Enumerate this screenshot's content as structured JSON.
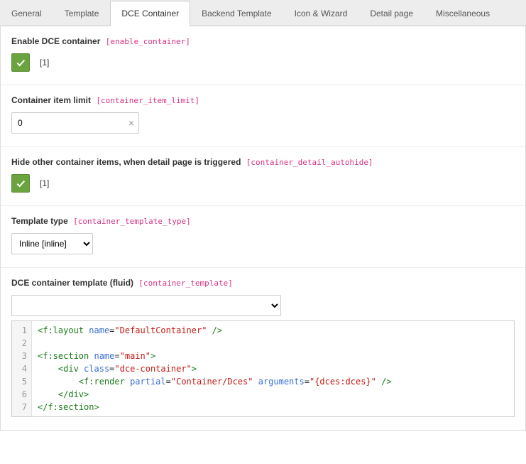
{
  "tabs": {
    "items": [
      {
        "label": "General"
      },
      {
        "label": "Template"
      },
      {
        "label": "DCE Container"
      },
      {
        "label": "Backend Template"
      },
      {
        "label": "Icon & Wizard"
      },
      {
        "label": "Detail page"
      },
      {
        "label": "Miscellaneous"
      }
    ],
    "active_index": 2
  },
  "sections": {
    "enable": {
      "label": "Enable DCE container",
      "field": "[enable_container]",
      "value_text": "[1]"
    },
    "limit": {
      "label": "Container item limit",
      "field": "[container_item_limit]",
      "value": "0"
    },
    "autohide": {
      "label": "Hide other container items, when detail page is triggered",
      "field": "[container_detail_autohide]",
      "value_text": "[1]"
    },
    "template_type": {
      "label": "Template type",
      "field": "[container_template_type]",
      "selected": "Inline [inline]"
    },
    "template": {
      "label": "DCE container template (fluid)",
      "field": "[container_template]",
      "selected": "",
      "code": {
        "lines": [
          "1",
          "2",
          "3",
          "4",
          "5",
          "6",
          "7"
        ],
        "l1_tag_open": "<f:layout",
        "l1_attr": "name",
        "l1_val": "\"DefaultContainer\"",
        "l1_tag_close": " />",
        "l3_tag_open": "<f:section",
        "l3_attr": "name",
        "l3_val": "\"main\"",
        "l3_tag_close": ">",
        "l4_open": "<div",
        "l4_attr": "class",
        "l4_val": "\"dce-container\"",
        "l4_close": ">",
        "l5_open": "<f:render",
        "l5_attr1": "partial",
        "l5_val1": "\"Container/Dces\"",
        "l5_attr2": "arguments",
        "l5_val2": "\"{dces:dces}\"",
        "l5_close": " />",
        "l6": "</div>",
        "l7": "</f:section>"
      }
    }
  }
}
